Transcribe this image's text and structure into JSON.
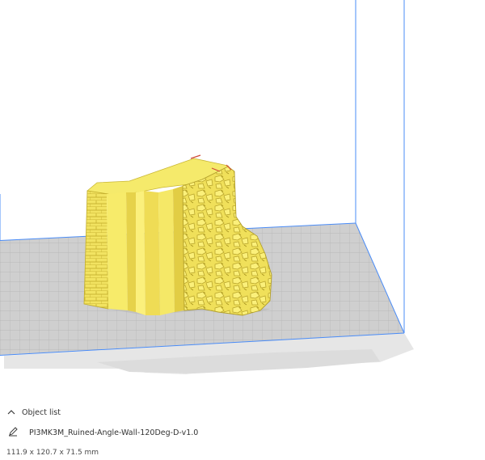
{
  "object_list": {
    "header_label": "Object list",
    "model_name": "PI3MK3M_Ruined-Angle-Wall-120Deg-D-v1.0",
    "dimensions": "111.9 x 120.7 x 71.5 mm"
  },
  "icons": {
    "collapse": "chevron-up-icon",
    "edit": "pencil-icon",
    "model": "ruined-wall-model"
  },
  "colors": {
    "build_volume_outline": "#4a8cf7",
    "build_plate": "#c8c8c8",
    "model_fill": "#f2e561"
  }
}
